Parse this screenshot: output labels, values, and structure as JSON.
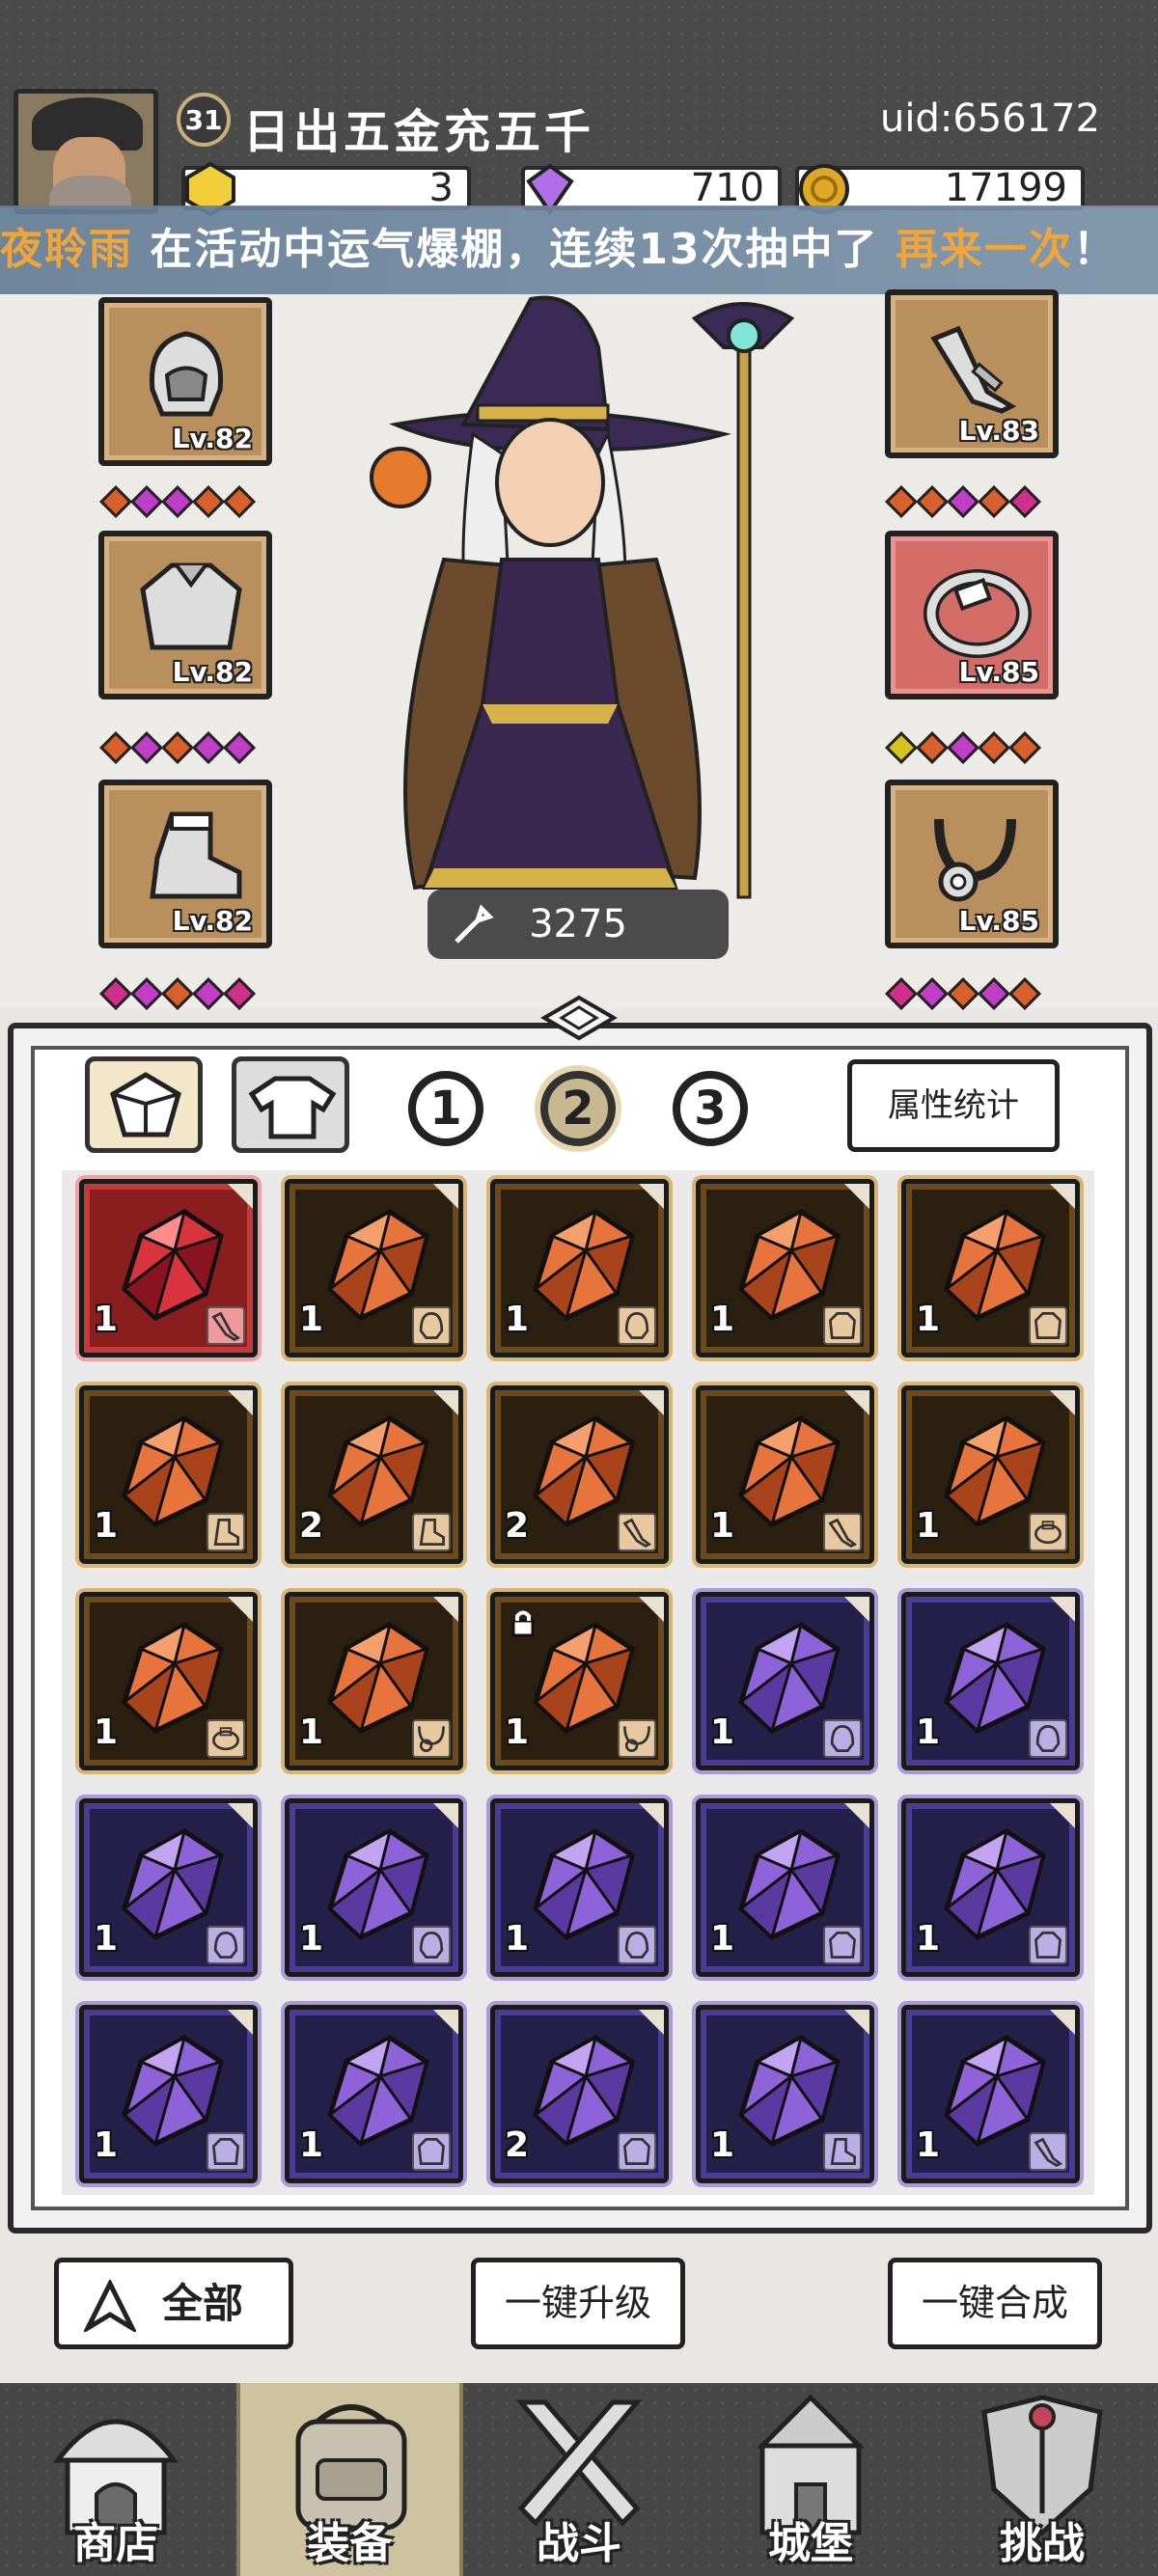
{
  "header": {
    "level": "31",
    "player_name": "日出五金充五千",
    "uid": "uid:656172",
    "resources": {
      "gold_ingot": "3",
      "gem": "710",
      "coin": "17199"
    }
  },
  "marquee": {
    "player": "夜聆雨",
    "text_mid": " 在活动中运气爆棚，连续13次抽中了 ",
    "prize": "再来一次",
    "text_end": "！"
  },
  "equipment": {
    "left": [
      {
        "name": "helmet",
        "level": "Lv.82"
      },
      {
        "name": "armor",
        "level": "Lv.82"
      },
      {
        "name": "boots",
        "level": "Lv.82"
      }
    ],
    "right": [
      {
        "name": "weapon",
        "level": "Lv.83"
      },
      {
        "name": "ring",
        "level": "Lv.85"
      },
      {
        "name": "necklace",
        "level": "Lv.85"
      }
    ],
    "power": "3275"
  },
  "inventory": {
    "pages": [
      "1",
      "2",
      "3"
    ],
    "active_page": "2",
    "stats_button": "属性统计",
    "items": [
      {
        "color": "red",
        "qty": "1",
        "slot_icon": "weapon-icon"
      },
      {
        "color": "orange",
        "qty": "1",
        "slot_icon": "helmet-icon"
      },
      {
        "color": "orange",
        "qty": "1",
        "slot_icon": "helmet-icon"
      },
      {
        "color": "orange",
        "qty": "1",
        "slot_icon": "armor-icon"
      },
      {
        "color": "orange",
        "qty": "1",
        "slot_icon": "armor-icon"
      },
      {
        "color": "orange",
        "qty": "1",
        "slot_icon": "boots-icon"
      },
      {
        "color": "orange",
        "qty": "2",
        "slot_icon": "boots-icon"
      },
      {
        "color": "orange",
        "qty": "2",
        "slot_icon": "weapon-icon"
      },
      {
        "color": "orange",
        "qty": "1",
        "slot_icon": "weapon-icon"
      },
      {
        "color": "orange",
        "qty": "1",
        "slot_icon": "ring-icon"
      },
      {
        "color": "orange",
        "qty": "1",
        "slot_icon": "ring-icon"
      },
      {
        "color": "orange",
        "qty": "1",
        "slot_icon": "necklace-icon"
      },
      {
        "color": "orange",
        "qty": "1",
        "slot_icon": "necklace-icon",
        "locked": true
      },
      {
        "color": "purple",
        "qty": "1",
        "slot_icon": "helmet-icon"
      },
      {
        "color": "purple",
        "qty": "1",
        "slot_icon": "helmet-icon"
      },
      {
        "color": "purple",
        "qty": "1",
        "slot_icon": "helmet-icon"
      },
      {
        "color": "purple",
        "qty": "1",
        "slot_icon": "helmet-icon"
      },
      {
        "color": "purple",
        "qty": "1",
        "slot_icon": "helmet-icon"
      },
      {
        "color": "purple",
        "qty": "1",
        "slot_icon": "armor-icon"
      },
      {
        "color": "purple",
        "qty": "1",
        "slot_icon": "armor-icon"
      },
      {
        "color": "purple",
        "qty": "1",
        "slot_icon": "armor-icon"
      },
      {
        "color": "purple",
        "qty": "1",
        "slot_icon": "armor-icon"
      },
      {
        "color": "purple",
        "qty": "2",
        "slot_icon": "armor-icon"
      },
      {
        "color": "purple",
        "qty": "1",
        "slot_icon": "boots-icon"
      },
      {
        "color": "purple",
        "qty": "1",
        "slot_icon": "weapon-icon"
      }
    ]
  },
  "actions": {
    "filter_all": "全部",
    "upgrade_all": "一键升级",
    "merge_all": "一键合成"
  },
  "nav": {
    "shop": "商店",
    "equipment": "装备",
    "battle": "战斗",
    "castle": "城堡",
    "challenge": "挑战"
  },
  "colors": {
    "accent_orange": "#f0a53a",
    "header_bg": "#4a4a4a",
    "slot_bronze": "#b98f5d",
    "slot_red": "#d46c68"
  }
}
